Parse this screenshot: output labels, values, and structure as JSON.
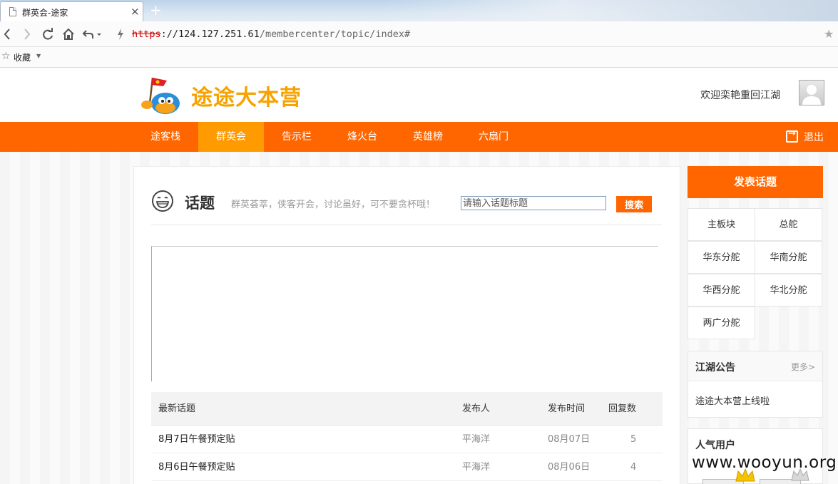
{
  "browser": {
    "tab_title": "群英会-途家",
    "tab_close": "×",
    "new_tab": "+",
    "url_scheme": "https",
    "url_host": "://124.127.251.61",
    "url_path": "/membercenter/topic/index#",
    "favorites_label": "收藏",
    "icons": [
      "back-icon",
      "forward-icon",
      "reload-icon",
      "home-icon",
      "undo-icon",
      "lightning-icon",
      "bookmark-star-icon"
    ]
  },
  "site": {
    "logo_text": "途途大本营",
    "welcome": "欢迎栾艳重回江湖",
    "logout": "退出",
    "accent_color": "#ff6600",
    "nav": [
      {
        "label": "途客栈",
        "active": false
      },
      {
        "label": "群英会",
        "active": true
      },
      {
        "label": "告示栏",
        "active": false
      },
      {
        "label": "烽火台",
        "active": false
      },
      {
        "label": "英雄榜",
        "active": false
      },
      {
        "label": "六扇门",
        "active": false
      }
    ]
  },
  "topic": {
    "title": "话题",
    "slogan": "群英荟萃，侠客开会，讨论虽好，可不要贪杯哦！",
    "search_placeholder": "请输入话题标题",
    "search_button": "搜索",
    "columns": [
      "最新话题",
      "发布人",
      "发布时间",
      "回复数"
    ],
    "rows": [
      {
        "title": "8月7日午餐预定贴",
        "author": "平海洋",
        "date": "08月07日",
        "replies": "5"
      },
      {
        "title": "8月6日午餐预定贴",
        "author": "平海洋",
        "date": "08月06日",
        "replies": "4"
      }
    ]
  },
  "sidebar": {
    "post_button": "发表话题",
    "boards": [
      "主板块",
      "总舵",
      "华东分舵",
      "华南分舵",
      "华西分舵",
      "华北分舵",
      "两广分舵"
    ],
    "notice_title": "江湖公告",
    "notice_more": "更多>",
    "notice_item": "途途大本营上线啦",
    "popular_title": "人气用户"
  },
  "watermark": "www.wooyun.org"
}
